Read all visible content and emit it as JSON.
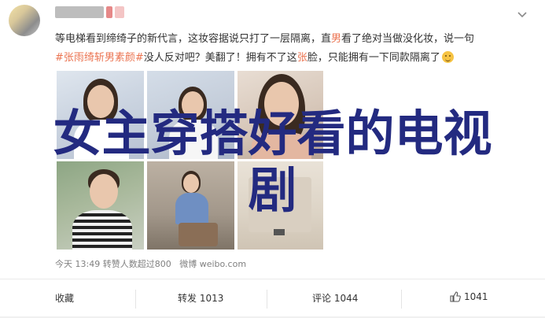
{
  "post": {
    "text_part1": "等电梯看到缔绮子的新代言，这妆容据说只打了一层隔离，直",
    "text_hl1": "男",
    "text_part2": "看了绝对当做没化妆，说一句",
    "tag": "#张雨绮斩男素颜#",
    "text_part3": "没人反对吧？美翻了！拥有不了这",
    "text_hl2": "张",
    "text_part4": "脸，只能拥有一下同款隔离了",
    "emoji": "laughing-emoji"
  },
  "overlay": {
    "title_line1": "女主穿搭好看的电视",
    "title_line2": "剧"
  },
  "meta": {
    "info": "今天 13:49 转赞人数超过800",
    "source": "微博 weibo.com"
  },
  "actions": {
    "favorite": "收藏",
    "repost": "转发 1013",
    "comment": "评论 1044",
    "like": "1041"
  },
  "colors": {
    "link": "#eb7350",
    "overlay_text": "#232a80"
  }
}
